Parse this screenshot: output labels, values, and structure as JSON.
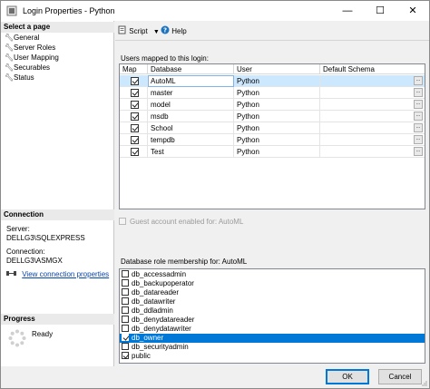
{
  "window": {
    "title": "Login Properties - Python",
    "controls": {
      "minimize": "—",
      "maximize": "☐",
      "close": "✕"
    }
  },
  "left_panel": {
    "select_page_header": "Select a page",
    "pages": [
      {
        "label": "General",
        "icon": "wrench-icon"
      },
      {
        "label": "Server Roles",
        "icon": "wrench-icon"
      },
      {
        "label": "User Mapping",
        "icon": "wrench-icon"
      },
      {
        "label": "Securables",
        "icon": "wrench-icon"
      },
      {
        "label": "Status",
        "icon": "wrench-icon"
      }
    ],
    "connection_header": "Connection",
    "server_label": "Server:",
    "server_value": "DELLG3\\SQLEXPRESS",
    "connection_label": "Connection:",
    "connection_value": "DELLG3\\ASMGX",
    "view_connection_link": "View connection properties",
    "progress_header": "Progress",
    "progress_status": "Ready"
  },
  "toolbar": {
    "script_label": "Script",
    "help_label": "Help"
  },
  "users_mapped": {
    "label": "Users mapped to this login:",
    "columns": [
      "Map",
      "Database",
      "User",
      "Default Schema"
    ],
    "rows": [
      {
        "map": true,
        "database": "AutoML",
        "user": "Python",
        "schema": "",
        "selected": true
      },
      {
        "map": true,
        "database": "master",
        "user": "Python",
        "schema": ""
      },
      {
        "map": true,
        "database": "model",
        "user": "Python",
        "schema": ""
      },
      {
        "map": true,
        "database": "msdb",
        "user": "Python",
        "schema": ""
      },
      {
        "map": true,
        "database": "School",
        "user": "Python",
        "schema": ""
      },
      {
        "map": true,
        "database": "tempdb",
        "user": "Python",
        "schema": ""
      },
      {
        "map": true,
        "database": "Test",
        "user": "Python",
        "schema": ""
      }
    ],
    "ellipsis_label": "..."
  },
  "guest_account": {
    "label": "Guest account enabled for: AutoML",
    "checked": false,
    "disabled": true
  },
  "role_membership": {
    "label": "Database role membership for: AutoML",
    "roles": [
      {
        "name": "db_accessadmin",
        "checked": false
      },
      {
        "name": "db_backupoperator",
        "checked": false
      },
      {
        "name": "db_datareader",
        "checked": false
      },
      {
        "name": "db_datawriter",
        "checked": false
      },
      {
        "name": "db_ddladmin",
        "checked": false
      },
      {
        "name": "db_denydatareader",
        "checked": false
      },
      {
        "name": "db_denydatawriter",
        "checked": false
      },
      {
        "name": "db_owner",
        "checked": true,
        "selected": true
      },
      {
        "name": "db_securityadmin",
        "checked": false
      },
      {
        "name": "public",
        "checked": true
      }
    ]
  },
  "footer": {
    "ok_label": "OK",
    "cancel_label": "Cancel"
  },
  "colors": {
    "selection_blue": "#0078d7",
    "row_highlight": "#cce8ff",
    "link_blue": "#0645ad"
  }
}
